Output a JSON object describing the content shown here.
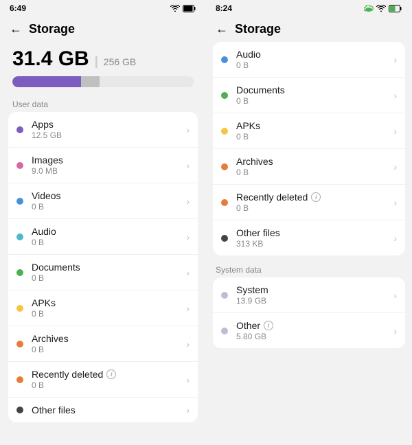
{
  "left": {
    "status": {
      "time": "6:49",
      "icons": "wifi battery"
    },
    "nav": {
      "back": "←",
      "title": "Storage"
    },
    "storage": {
      "used": "31.4 GB",
      "separator": "|",
      "total": "256 GB"
    },
    "user_data_label": "User data",
    "items": [
      {
        "name": "Apps",
        "size": "12.5 GB",
        "dot": "dot-purple"
      },
      {
        "name": "Images",
        "size": "9.0 MB",
        "dot": "dot-pink"
      },
      {
        "name": "Videos",
        "size": "0 B",
        "dot": "dot-blue"
      },
      {
        "name": "Audio",
        "size": "0 B",
        "dot": "dot-teal"
      },
      {
        "name": "Documents",
        "size": "0 B",
        "dot": "dot-green"
      },
      {
        "name": "APKs",
        "size": "0 B",
        "dot": "dot-yellow"
      },
      {
        "name": "Archives",
        "size": "0 B",
        "dot": "dot-orange",
        "info": false
      },
      {
        "name": "Recently deleted",
        "size": "0 B",
        "dot": "dot-orange",
        "info": true
      },
      {
        "name": "Other files",
        "size": "",
        "dot": "dot-dark",
        "info": false,
        "noChevron": false
      }
    ]
  },
  "right": {
    "status": {
      "time": "8:24",
      "icons": "wifi battery"
    },
    "nav": {
      "back": "←",
      "title": "Storage"
    },
    "user_data_items": [
      {
        "name": "Audio",
        "size": "0 B",
        "dot": "dot-blue"
      },
      {
        "name": "Documents",
        "size": "0 B",
        "dot": "dot-green"
      },
      {
        "name": "APKs",
        "size": "0 B",
        "dot": "dot-yellow"
      },
      {
        "name": "Archives",
        "size": "0 B",
        "dot": "dot-orange",
        "info": false
      },
      {
        "name": "Recently deleted",
        "size": "0 B",
        "dot": "dot-orange",
        "info": true
      },
      {
        "name": "Other files",
        "size": "313 KB",
        "dot": "dot-dark"
      }
    ],
    "system_data_label": "System data",
    "system_items": [
      {
        "name": "System",
        "size": "13.9 GB",
        "dot": "dot-lightgray",
        "info": false
      },
      {
        "name": "Other",
        "size": "5.80 GB",
        "dot": "dot-lightgray",
        "info": true
      }
    ]
  }
}
